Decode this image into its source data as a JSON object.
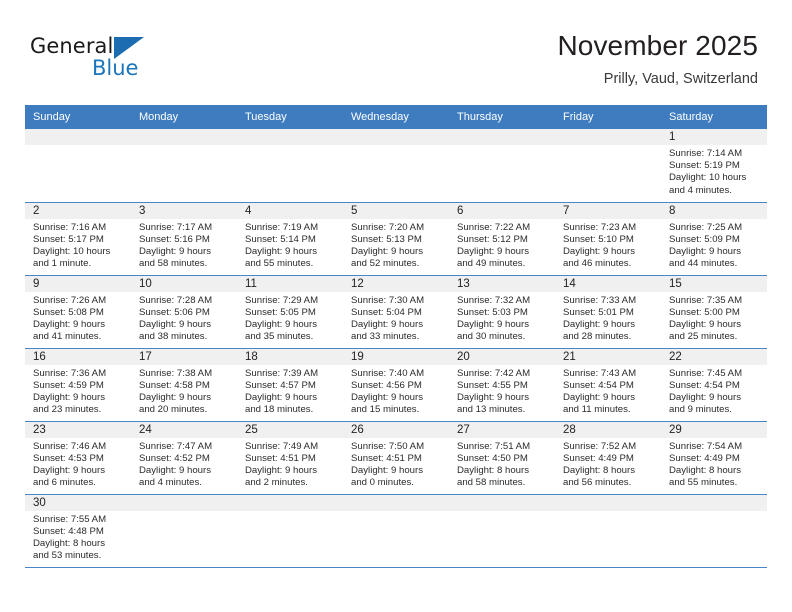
{
  "brand": {
    "name_part1": "General",
    "name_part2": "Blue",
    "flag_icon": "triangle-flag-icon"
  },
  "header": {
    "title": "November 2025",
    "subtitle": "Prilly, Vaud, Switzerland"
  },
  "colors": {
    "header_blue": "#3e7cbf",
    "row_divider_blue": "#4a86c5",
    "daynum_band": "#f0f0f0",
    "brand_blue": "#1b75bb",
    "text": "#231f20"
  },
  "weekdays": [
    "Sunday",
    "Monday",
    "Tuesday",
    "Wednesday",
    "Thursday",
    "Friday",
    "Saturday"
  ],
  "weeks": [
    [
      {
        "blank": true
      },
      {
        "blank": true
      },
      {
        "blank": true
      },
      {
        "blank": true
      },
      {
        "blank": true
      },
      {
        "blank": true
      },
      {
        "day": "1",
        "sunrise": "Sunrise: 7:14 AM",
        "sunset": "Sunset: 5:19 PM",
        "daylight_line1": "Daylight: 10 hours",
        "daylight_line2": "and 4 minutes."
      }
    ],
    [
      {
        "day": "2",
        "sunrise": "Sunrise: 7:16 AM",
        "sunset": "Sunset: 5:17 PM",
        "daylight_line1": "Daylight: 10 hours",
        "daylight_line2": "and 1 minute."
      },
      {
        "day": "3",
        "sunrise": "Sunrise: 7:17 AM",
        "sunset": "Sunset: 5:16 PM",
        "daylight_line1": "Daylight: 9 hours",
        "daylight_line2": "and 58 minutes."
      },
      {
        "day": "4",
        "sunrise": "Sunrise: 7:19 AM",
        "sunset": "Sunset: 5:14 PM",
        "daylight_line1": "Daylight: 9 hours",
        "daylight_line2": "and 55 minutes."
      },
      {
        "day": "5",
        "sunrise": "Sunrise: 7:20 AM",
        "sunset": "Sunset: 5:13 PM",
        "daylight_line1": "Daylight: 9 hours",
        "daylight_line2": "and 52 minutes."
      },
      {
        "day": "6",
        "sunrise": "Sunrise: 7:22 AM",
        "sunset": "Sunset: 5:12 PM",
        "daylight_line1": "Daylight: 9 hours",
        "daylight_line2": "and 49 minutes."
      },
      {
        "day": "7",
        "sunrise": "Sunrise: 7:23 AM",
        "sunset": "Sunset: 5:10 PM",
        "daylight_line1": "Daylight: 9 hours",
        "daylight_line2": "and 46 minutes."
      },
      {
        "day": "8",
        "sunrise": "Sunrise: 7:25 AM",
        "sunset": "Sunset: 5:09 PM",
        "daylight_line1": "Daylight: 9 hours",
        "daylight_line2": "and 44 minutes."
      }
    ],
    [
      {
        "day": "9",
        "sunrise": "Sunrise: 7:26 AM",
        "sunset": "Sunset: 5:08 PM",
        "daylight_line1": "Daylight: 9 hours",
        "daylight_line2": "and 41 minutes."
      },
      {
        "day": "10",
        "sunrise": "Sunrise: 7:28 AM",
        "sunset": "Sunset: 5:06 PM",
        "daylight_line1": "Daylight: 9 hours",
        "daylight_line2": "and 38 minutes."
      },
      {
        "day": "11",
        "sunrise": "Sunrise: 7:29 AM",
        "sunset": "Sunset: 5:05 PM",
        "daylight_line1": "Daylight: 9 hours",
        "daylight_line2": "and 35 minutes."
      },
      {
        "day": "12",
        "sunrise": "Sunrise: 7:30 AM",
        "sunset": "Sunset: 5:04 PM",
        "daylight_line1": "Daylight: 9 hours",
        "daylight_line2": "and 33 minutes."
      },
      {
        "day": "13",
        "sunrise": "Sunrise: 7:32 AM",
        "sunset": "Sunset: 5:03 PM",
        "daylight_line1": "Daylight: 9 hours",
        "daylight_line2": "and 30 minutes."
      },
      {
        "day": "14",
        "sunrise": "Sunrise: 7:33 AM",
        "sunset": "Sunset: 5:01 PM",
        "daylight_line1": "Daylight: 9 hours",
        "daylight_line2": "and 28 minutes."
      },
      {
        "day": "15",
        "sunrise": "Sunrise: 7:35 AM",
        "sunset": "Sunset: 5:00 PM",
        "daylight_line1": "Daylight: 9 hours",
        "daylight_line2": "and 25 minutes."
      }
    ],
    [
      {
        "day": "16",
        "sunrise": "Sunrise: 7:36 AM",
        "sunset": "Sunset: 4:59 PM",
        "daylight_line1": "Daylight: 9 hours",
        "daylight_line2": "and 23 minutes."
      },
      {
        "day": "17",
        "sunrise": "Sunrise: 7:38 AM",
        "sunset": "Sunset: 4:58 PM",
        "daylight_line1": "Daylight: 9 hours",
        "daylight_line2": "and 20 minutes."
      },
      {
        "day": "18",
        "sunrise": "Sunrise: 7:39 AM",
        "sunset": "Sunset: 4:57 PM",
        "daylight_line1": "Daylight: 9 hours",
        "daylight_line2": "and 18 minutes."
      },
      {
        "day": "19",
        "sunrise": "Sunrise: 7:40 AM",
        "sunset": "Sunset: 4:56 PM",
        "daylight_line1": "Daylight: 9 hours",
        "daylight_line2": "and 15 minutes."
      },
      {
        "day": "20",
        "sunrise": "Sunrise: 7:42 AM",
        "sunset": "Sunset: 4:55 PM",
        "daylight_line1": "Daylight: 9 hours",
        "daylight_line2": "and 13 minutes."
      },
      {
        "day": "21",
        "sunrise": "Sunrise: 7:43 AM",
        "sunset": "Sunset: 4:54 PM",
        "daylight_line1": "Daylight: 9 hours",
        "daylight_line2": "and 11 minutes."
      },
      {
        "day": "22",
        "sunrise": "Sunrise: 7:45 AM",
        "sunset": "Sunset: 4:54 PM",
        "daylight_line1": "Daylight: 9 hours",
        "daylight_line2": "and 9 minutes."
      }
    ],
    [
      {
        "day": "23",
        "sunrise": "Sunrise: 7:46 AM",
        "sunset": "Sunset: 4:53 PM",
        "daylight_line1": "Daylight: 9 hours",
        "daylight_line2": "and 6 minutes."
      },
      {
        "day": "24",
        "sunrise": "Sunrise: 7:47 AM",
        "sunset": "Sunset: 4:52 PM",
        "daylight_line1": "Daylight: 9 hours",
        "daylight_line2": "and 4 minutes."
      },
      {
        "day": "25",
        "sunrise": "Sunrise: 7:49 AM",
        "sunset": "Sunset: 4:51 PM",
        "daylight_line1": "Daylight: 9 hours",
        "daylight_line2": "and 2 minutes."
      },
      {
        "day": "26",
        "sunrise": "Sunrise: 7:50 AM",
        "sunset": "Sunset: 4:51 PM",
        "daylight_line1": "Daylight: 9 hours",
        "daylight_line2": "and 0 minutes."
      },
      {
        "day": "27",
        "sunrise": "Sunrise: 7:51 AM",
        "sunset": "Sunset: 4:50 PM",
        "daylight_line1": "Daylight: 8 hours",
        "daylight_line2": "and 58 minutes."
      },
      {
        "day": "28",
        "sunrise": "Sunrise: 7:52 AM",
        "sunset": "Sunset: 4:49 PM",
        "daylight_line1": "Daylight: 8 hours",
        "daylight_line2": "and 56 minutes."
      },
      {
        "day": "29",
        "sunrise": "Sunrise: 7:54 AM",
        "sunset": "Sunset: 4:49 PM",
        "daylight_line1": "Daylight: 8 hours",
        "daylight_line2": "and 55 minutes."
      }
    ],
    [
      {
        "day": "30",
        "sunrise": "Sunrise: 7:55 AM",
        "sunset": "Sunset: 4:48 PM",
        "daylight_line1": "Daylight: 8 hours",
        "daylight_line2": "and 53 minutes."
      },
      {
        "blank": true
      },
      {
        "blank": true
      },
      {
        "blank": true
      },
      {
        "blank": true
      },
      {
        "blank": true
      },
      {
        "blank": true
      }
    ]
  ]
}
